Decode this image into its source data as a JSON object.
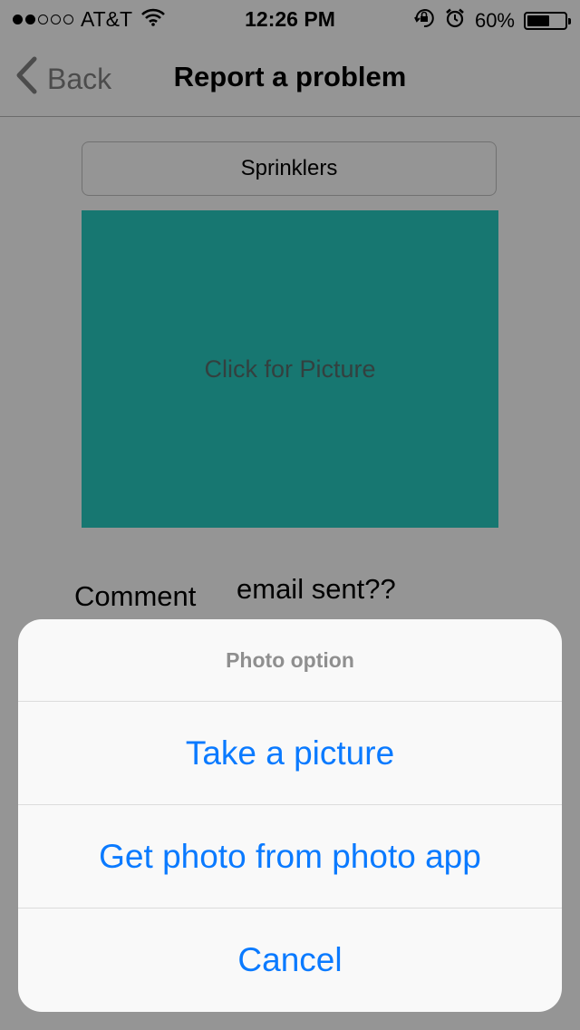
{
  "status_bar": {
    "carrier": "AT&T",
    "time": "12:26 PM",
    "battery_text": "60%",
    "battery_level": 0.6,
    "signal_bars_filled": 2,
    "signal_bars_total": 5
  },
  "nav": {
    "back_label": "Back",
    "title": "Report a problem"
  },
  "form": {
    "category": "Sprinklers",
    "picture_label": "Click for Picture",
    "comment_label": "Comment",
    "comment_value": "email sent??"
  },
  "action_sheet": {
    "title": "Photo option",
    "actions": [
      {
        "label": "Take a picture"
      },
      {
        "label": "Get photo from photo app"
      },
      {
        "label": "Cancel"
      }
    ]
  },
  "colors": {
    "accent": "#0a7aff",
    "picture_bg": "#27c7bc"
  },
  "icons": [
    "wifi-icon",
    "orientation-lock-icon",
    "alarm-icon",
    "battery-icon",
    "back-chevron-icon"
  ]
}
